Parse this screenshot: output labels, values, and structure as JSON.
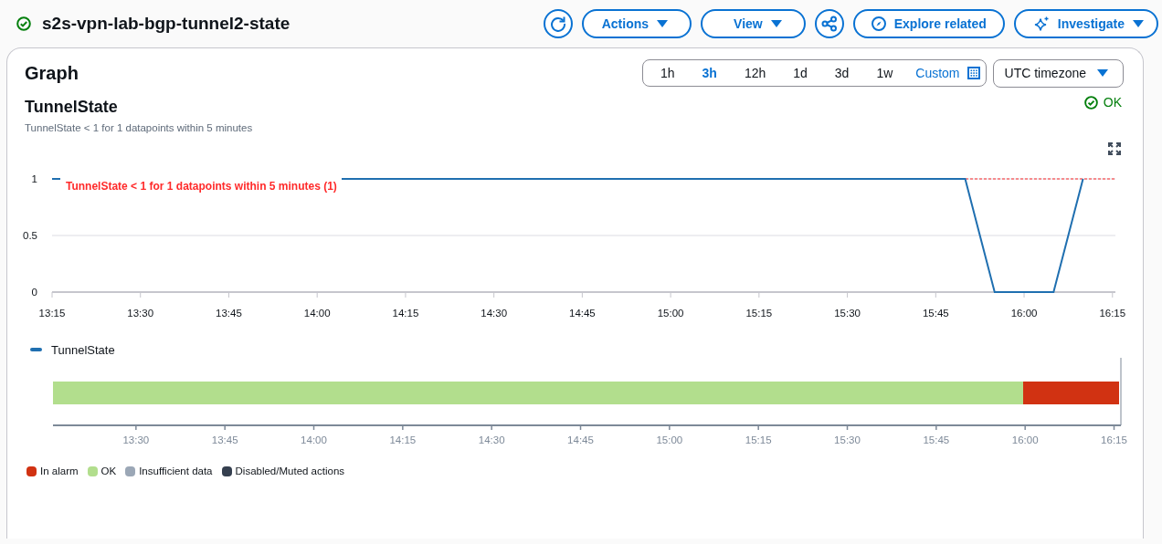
{
  "title": "s2s-vpn-lab-bgp-tunnel2-state",
  "toolbar": [
    {
      "kind": "refresh"
    },
    {
      "kind": "dropdown",
      "label": "Actions"
    },
    {
      "kind": "dropdown",
      "label": "View"
    },
    {
      "kind": "share"
    },
    {
      "kind": "explore",
      "label": "Explore related"
    },
    {
      "kind": "investigate",
      "label": "Investigate"
    }
  ],
  "graph": {
    "heading": "Graph",
    "time_ranges": [
      {
        "label": "1h",
        "selected": false
      },
      {
        "label": "3h",
        "selected": true
      },
      {
        "label": "12h",
        "selected": false
      },
      {
        "label": "1d",
        "selected": false
      },
      {
        "label": "3d",
        "selected": false
      },
      {
        "label": "1w",
        "selected": false
      }
    ],
    "custom_label": "Custom",
    "timezone": "UTC timezone",
    "alarm": {
      "name": "TunnelState",
      "description": "TunnelState < 1 for 1 datapoints within 5 minutes",
      "state_label": "OK"
    },
    "chart_data": {
      "type": "line",
      "x": [
        795,
        950,
        955,
        965,
        970
      ],
      "xlim": [
        795,
        975.5
      ],
      "ylim": [
        0,
        1
      ],
      "yticks": [
        0,
        0.5,
        1
      ],
      "xticks": [
        {
          "value": 795,
          "label": "13:15"
        },
        {
          "value": 810,
          "label": "13:30"
        },
        {
          "value": 825,
          "label": "13:45"
        },
        {
          "value": 840,
          "label": "14:00"
        },
        {
          "value": 855,
          "label": "14:15"
        },
        {
          "value": 870,
          "label": "14:30"
        },
        {
          "value": 885,
          "label": "14:45"
        },
        {
          "value": 900,
          "label": "15:00"
        },
        {
          "value": 915,
          "label": "15:15"
        },
        {
          "value": 930,
          "label": "15:30"
        },
        {
          "value": 945,
          "label": "15:45"
        },
        {
          "value": 960,
          "label": "16:00"
        },
        {
          "value": 975,
          "label": "16:15"
        }
      ],
      "series": [
        {
          "name": "TunnelState",
          "color": "#1f6fb0",
          "values": [
            1,
            1,
            0,
            0,
            1
          ]
        }
      ],
      "ref_lines": [
        {
          "axis": "y",
          "value": 1,
          "label": "TunnelState < 1 for 1 datapoints within 5 minutes (1)",
          "color": "#ff2a2a"
        }
      ]
    },
    "status_timeline": {
      "axis_labels": [
        "13:30",
        "13:45",
        "14:00",
        "14:15",
        "14:30",
        "14:45",
        "15:00",
        "15:15",
        "15:30",
        "15:45",
        "16:00",
        "16:15"
      ],
      "segments": [
        {
          "color": "#b2de8d",
          "level": 0.91
        },
        {
          "color": "#d13212"
        }
      ]
    },
    "state_legend": [
      {
        "label": "In alarm",
        "color": "#d13212"
      },
      {
        "label": "OK",
        "color": "#b2de8d"
      },
      {
        "label": "Insufficient data",
        "color": "#9ba7b6"
      },
      {
        "label": "Disabled/Muted actions",
        "color": "#353f4f"
      }
    ]
  }
}
